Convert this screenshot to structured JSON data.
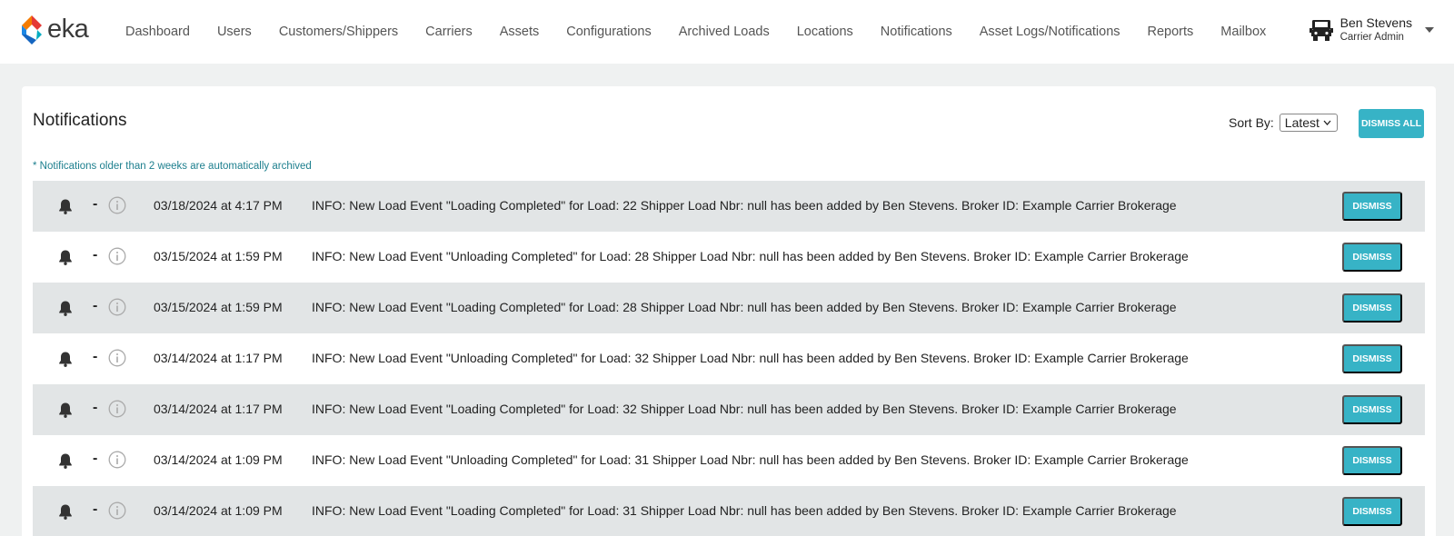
{
  "brand": {
    "name": "eka"
  },
  "nav": {
    "items": [
      "Dashboard",
      "Users",
      "Customers/Shippers",
      "Carriers",
      "Assets",
      "Configurations",
      "Archived Loads",
      "Locations",
      "Notifications",
      "Asset Logs/Notifications",
      "Reports",
      "Mailbox"
    ]
  },
  "user": {
    "name": "Ben Stevens",
    "role": "Carrier Admin",
    "icon": "truck-icon"
  },
  "page": {
    "title": "Notifications",
    "sort_label": "Sort By:",
    "sort_value": "Latest",
    "dismiss_all_label": "DISMISS ALL",
    "archive_note": "* Notifications older than 2 weeks are automatically archived"
  },
  "notifications": [
    {
      "dash": "-",
      "date": "03/18/2024 at 4:17 PM",
      "message": "INFO: New Load Event \"Loading Completed\" for Load: 22 Shipper Load Nbr: null has been added by Ben Stevens. Broker ID: Example Carrier Brokerage",
      "dismiss": "DISMISS"
    },
    {
      "dash": "-",
      "date": "03/15/2024 at 1:59 PM",
      "message": "INFO: New Load Event \"Unloading Completed\" for Load: 28 Shipper Load Nbr: null has been added by Ben Stevens. Broker ID: Example Carrier Brokerage",
      "dismiss": "DISMISS"
    },
    {
      "dash": "-",
      "date": "03/15/2024 at 1:59 PM",
      "message": "INFO: New Load Event \"Loading Completed\" for Load: 28 Shipper Load Nbr: null has been added by Ben Stevens. Broker ID: Example Carrier Brokerage",
      "dismiss": "DISMISS"
    },
    {
      "dash": "-",
      "date": "03/14/2024 at 1:17 PM",
      "message": "INFO: New Load Event \"Unloading Completed\" for Load: 32 Shipper Load Nbr: null has been added by Ben Stevens. Broker ID: Example Carrier Brokerage",
      "dismiss": "DISMISS"
    },
    {
      "dash": "-",
      "date": "03/14/2024 at 1:17 PM",
      "message": "INFO: New Load Event \"Loading Completed\" for Load: 32 Shipper Load Nbr: null has been added by Ben Stevens. Broker ID: Example Carrier Brokerage",
      "dismiss": "DISMISS"
    },
    {
      "dash": "-",
      "date": "03/14/2024 at 1:09 PM",
      "message": "INFO: New Load Event \"Unloading Completed\" for Load: 31 Shipper Load Nbr: null has been added by Ben Stevens. Broker ID: Example Carrier Brokerage",
      "dismiss": "DISMISS"
    },
    {
      "dash": "-",
      "date": "03/14/2024 at 1:09 PM",
      "message": "INFO: New Load Event \"Loading Completed\" for Load: 31 Shipper Load Nbr: null has been added by Ben Stevens. Broker ID: Example Carrier Brokerage",
      "dismiss": "DISMISS"
    }
  ],
  "colors": {
    "accent": "#37b3c6",
    "note": "#1d7f8e",
    "row_shade": "#e2e5e6",
    "page_bg": "#eff1f1"
  }
}
